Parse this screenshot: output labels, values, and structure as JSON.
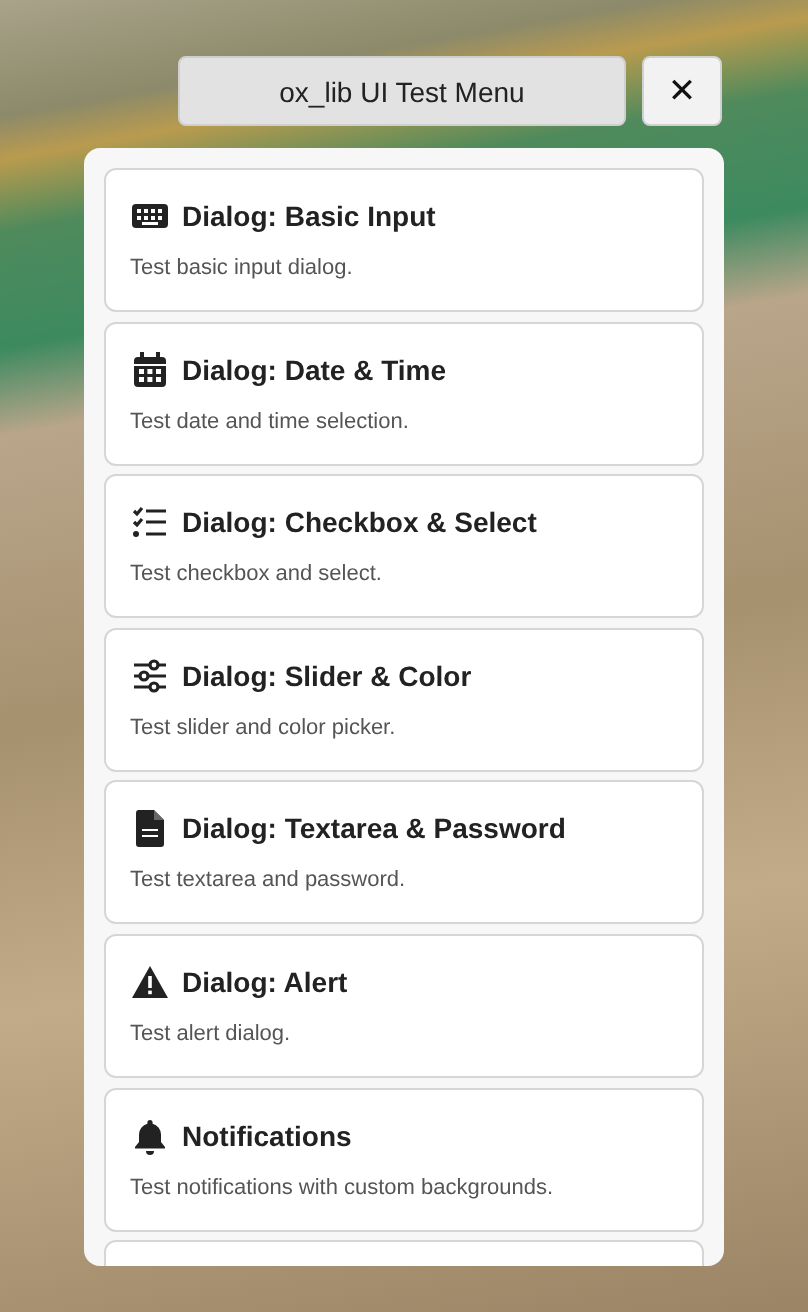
{
  "menu": {
    "title": "ox_lib UI Test Menu",
    "close_label": "✕"
  },
  "items": [
    {
      "kind": "keyboard",
      "title": "Dialog: Basic Input",
      "description": "Test basic input dialog."
    },
    {
      "kind": "calendar",
      "title": "Dialog: Date & Time",
      "description": "Test date and time selection."
    },
    {
      "kind": "checklist",
      "title": "Dialog: Checkbox & Select",
      "description": "Test checkbox and select."
    },
    {
      "kind": "sliders",
      "title": "Dialog: Slider & Color",
      "description": "Test slider and color picker."
    },
    {
      "kind": "file",
      "title": "Dialog: Textarea & Password",
      "description": "Test textarea and password."
    },
    {
      "kind": "warning",
      "title": "Dialog: Alert",
      "description": "Test alert dialog."
    },
    {
      "kind": "bell",
      "title": "Notifications",
      "description": "Test notifications with custom backgrounds."
    }
  ]
}
